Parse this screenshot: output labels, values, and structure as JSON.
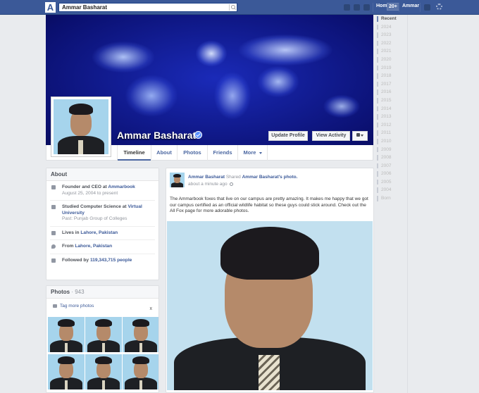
{
  "topbar": {
    "logo": "A",
    "search_value": "Ammar Basharat",
    "home_label": "Home",
    "home_count": "20+",
    "user_label": "Ammar"
  },
  "profile": {
    "name": "Ammar Basharat",
    "update_profile_label": "Update Profile",
    "view_activity_label": "View Activity"
  },
  "nav": {
    "tabs": [
      "Timeline",
      "About",
      "Photos",
      "Friends",
      "More"
    ]
  },
  "timeline_years": [
    "Recent",
    "2024",
    "2023",
    "2022",
    "2021",
    "2020",
    "2019",
    "2018",
    "2017",
    "2016",
    "2015",
    "2014",
    "2013",
    "2012",
    "2011",
    "2010",
    "2009",
    "2008",
    "2007",
    "2006",
    "2005",
    "2004",
    "Born"
  ],
  "about": {
    "title": "About",
    "work_prefix": "Founder and CEO at ",
    "work_link": "Ammarbook",
    "work_sub": "August 25, 2004 to present",
    "edu_prefix": "Studied Computer Science at ",
    "edu_link_1": "Virtual",
    "edu_link_2": "University",
    "edu_sub": "Past: Punjab Group of Colleges",
    "lives_prefix": "Lives in ",
    "lives_link": "Lahore, Pakistan",
    "from_prefix": "From ",
    "from_link": "Lahore, Pakistan",
    "followed_prefix": "Followed by ",
    "followed_link": "119,343,715 people"
  },
  "photos": {
    "title": "Photos",
    "count": " · 943",
    "tag_more": "Tag more photos",
    "close": "x"
  },
  "post": {
    "author": "Ammar Basharat",
    "action": " Shared ",
    "target": "Ammar Basharat's photo.",
    "time": "about a minute ago",
    "text": "The Ammarbook foxes that live on our campus are pretty amazing. It makes me happy that we got our campus certified as an official wildlife habitat so these guys could stick around. Check out the All Fox page for more adorable photos."
  },
  "colors": {
    "brand": "#3b5998",
    "cover": "#0a0f6e"
  }
}
